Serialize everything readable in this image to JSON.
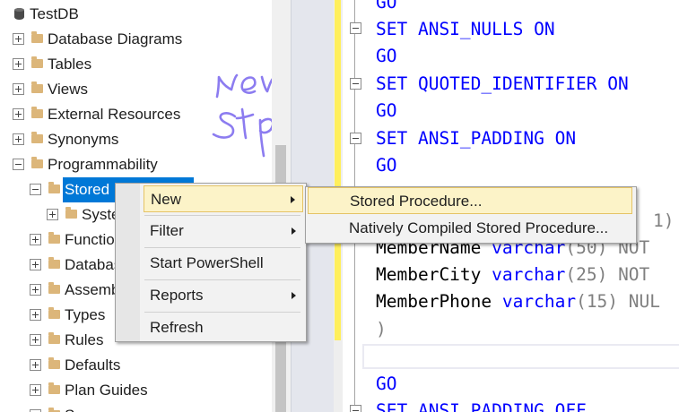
{
  "tree": {
    "root": "TestDB",
    "items": [
      {
        "label": "Database Diagrams",
        "icon": "folder-icon"
      },
      {
        "label": "Tables",
        "icon": "folder-icon"
      },
      {
        "label": "Views",
        "icon": "folder-icon"
      },
      {
        "label": "External Resources",
        "icon": "folder-icon"
      },
      {
        "label": "Synonyms",
        "icon": "folder-icon"
      },
      {
        "label": "Programmability",
        "icon": "folder-icon"
      }
    ],
    "children": [
      {
        "label": "Stored Procedures",
        "selected": true
      },
      {
        "label": "System Stored Procedures"
      },
      {
        "label": "Functions"
      },
      {
        "label": "Database Triggers"
      },
      {
        "label": "Assemblies"
      },
      {
        "label": "Types"
      },
      {
        "label": "Rules"
      },
      {
        "label": "Defaults"
      },
      {
        "label": "Plan Guides"
      },
      {
        "label": "Sequences"
      }
    ]
  },
  "context_menu": {
    "items": [
      "New",
      "Filter",
      "Start PowerShell",
      "Reports",
      "Refresh"
    ],
    "highlighted": "New"
  },
  "submenu": {
    "items": [
      "Stored Procedure...",
      "Natively Compiled Stored Procedure..."
    ],
    "highlighted": "Stored Procedure..."
  },
  "editor": {
    "go": "GO",
    "set_ansi_nulls": "SET ANSI_NULLS ON",
    "set_quoted_identifier": "SET QUOTED_IDENTIFIER ON",
    "set_ansi_padding": "SET ANSI_PADDING ON",
    "set_ansi_padding_off": "SET ANSI_PADDING OFF",
    "hidden_line_tail": "1)",
    "col_member_name": "MemberName",
    "col_member_city": "MemberCity",
    "col_member_phone": "MemberPhone",
    "type_varchar": "varchar",
    "len_50": "(50)",
    "len_25": "(25)",
    "len_15": "(15)",
    "not_null": "NOT",
    "null_kw": "NUL",
    "close_paren": ")"
  },
  "annotation": {
    "text": "new stp",
    "color": "#8c7cf0"
  },
  "colors": {
    "selection": "#0078d7",
    "keyword": "#0000ff",
    "menu_highlight": "#fcf3c8",
    "change_bar": "#ffef5c"
  }
}
